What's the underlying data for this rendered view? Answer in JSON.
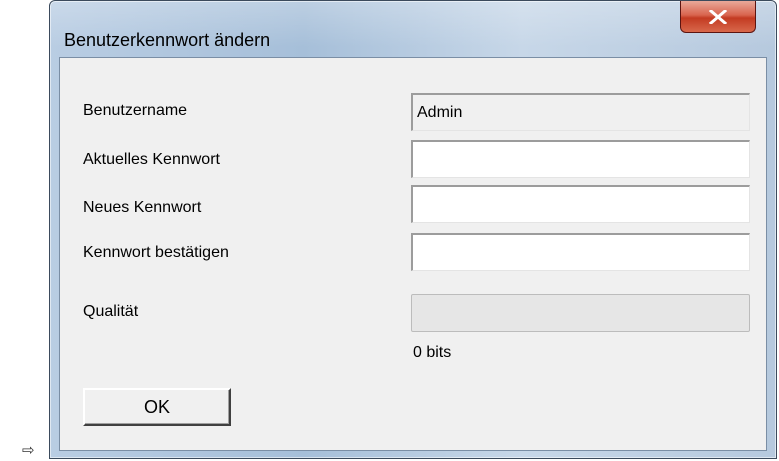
{
  "marker": {
    "arrow": "⇨"
  },
  "window": {
    "title": "Benutzerkennwort ändern",
    "close_icon": "close-x-icon"
  },
  "form": {
    "fields": [
      {
        "label": "Benutzername",
        "value": "Admin",
        "readonly": true
      },
      {
        "label": "Aktuelles Kennwort",
        "value": ""
      },
      {
        "label": "Neues Kennwort",
        "value": ""
      },
      {
        "label": "Kennwort bestätigen",
        "value": ""
      }
    ],
    "quality": {
      "label": "Qualität",
      "level": 0,
      "bits_text": "0 bits"
    },
    "ok_label": "OK"
  },
  "colors": {
    "close_button": "#c33b22",
    "client_background": "#f0f0f0",
    "quality_fill": "#06b025"
  }
}
